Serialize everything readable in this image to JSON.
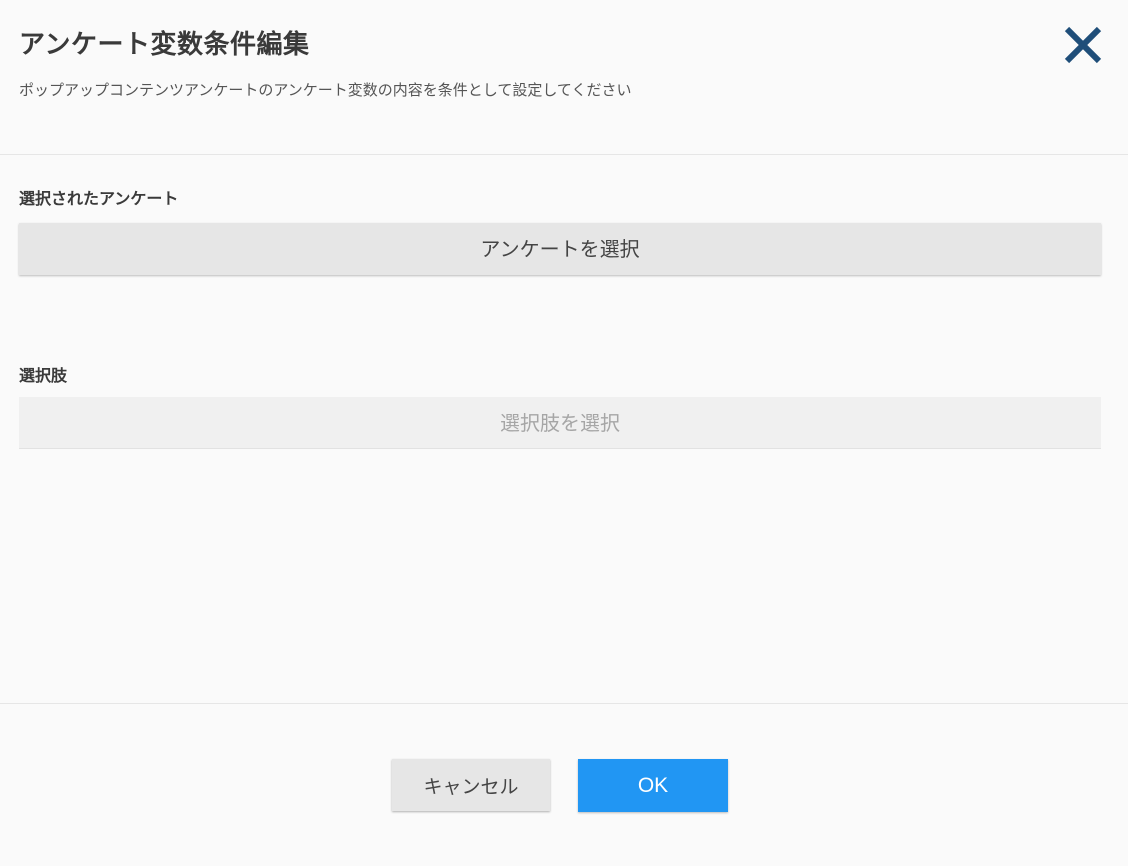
{
  "dialog": {
    "title": "アンケート変数条件編集",
    "subtitle": "ポップアップコンテンツアンケートのアンケート変数の内容を条件として設定してください",
    "close_icon": "close-icon"
  },
  "survey_section": {
    "label": "選択されたアンケート",
    "button_label": "アンケートを選択"
  },
  "choice_section": {
    "label": "選択肢",
    "button_label": "選択肢を選択"
  },
  "footer": {
    "cancel_label": "キャンセル",
    "ok_label": "OK"
  },
  "colors": {
    "accent": "#2196f3",
    "close_icon": "#1f4e79",
    "background": "#fafafa"
  }
}
